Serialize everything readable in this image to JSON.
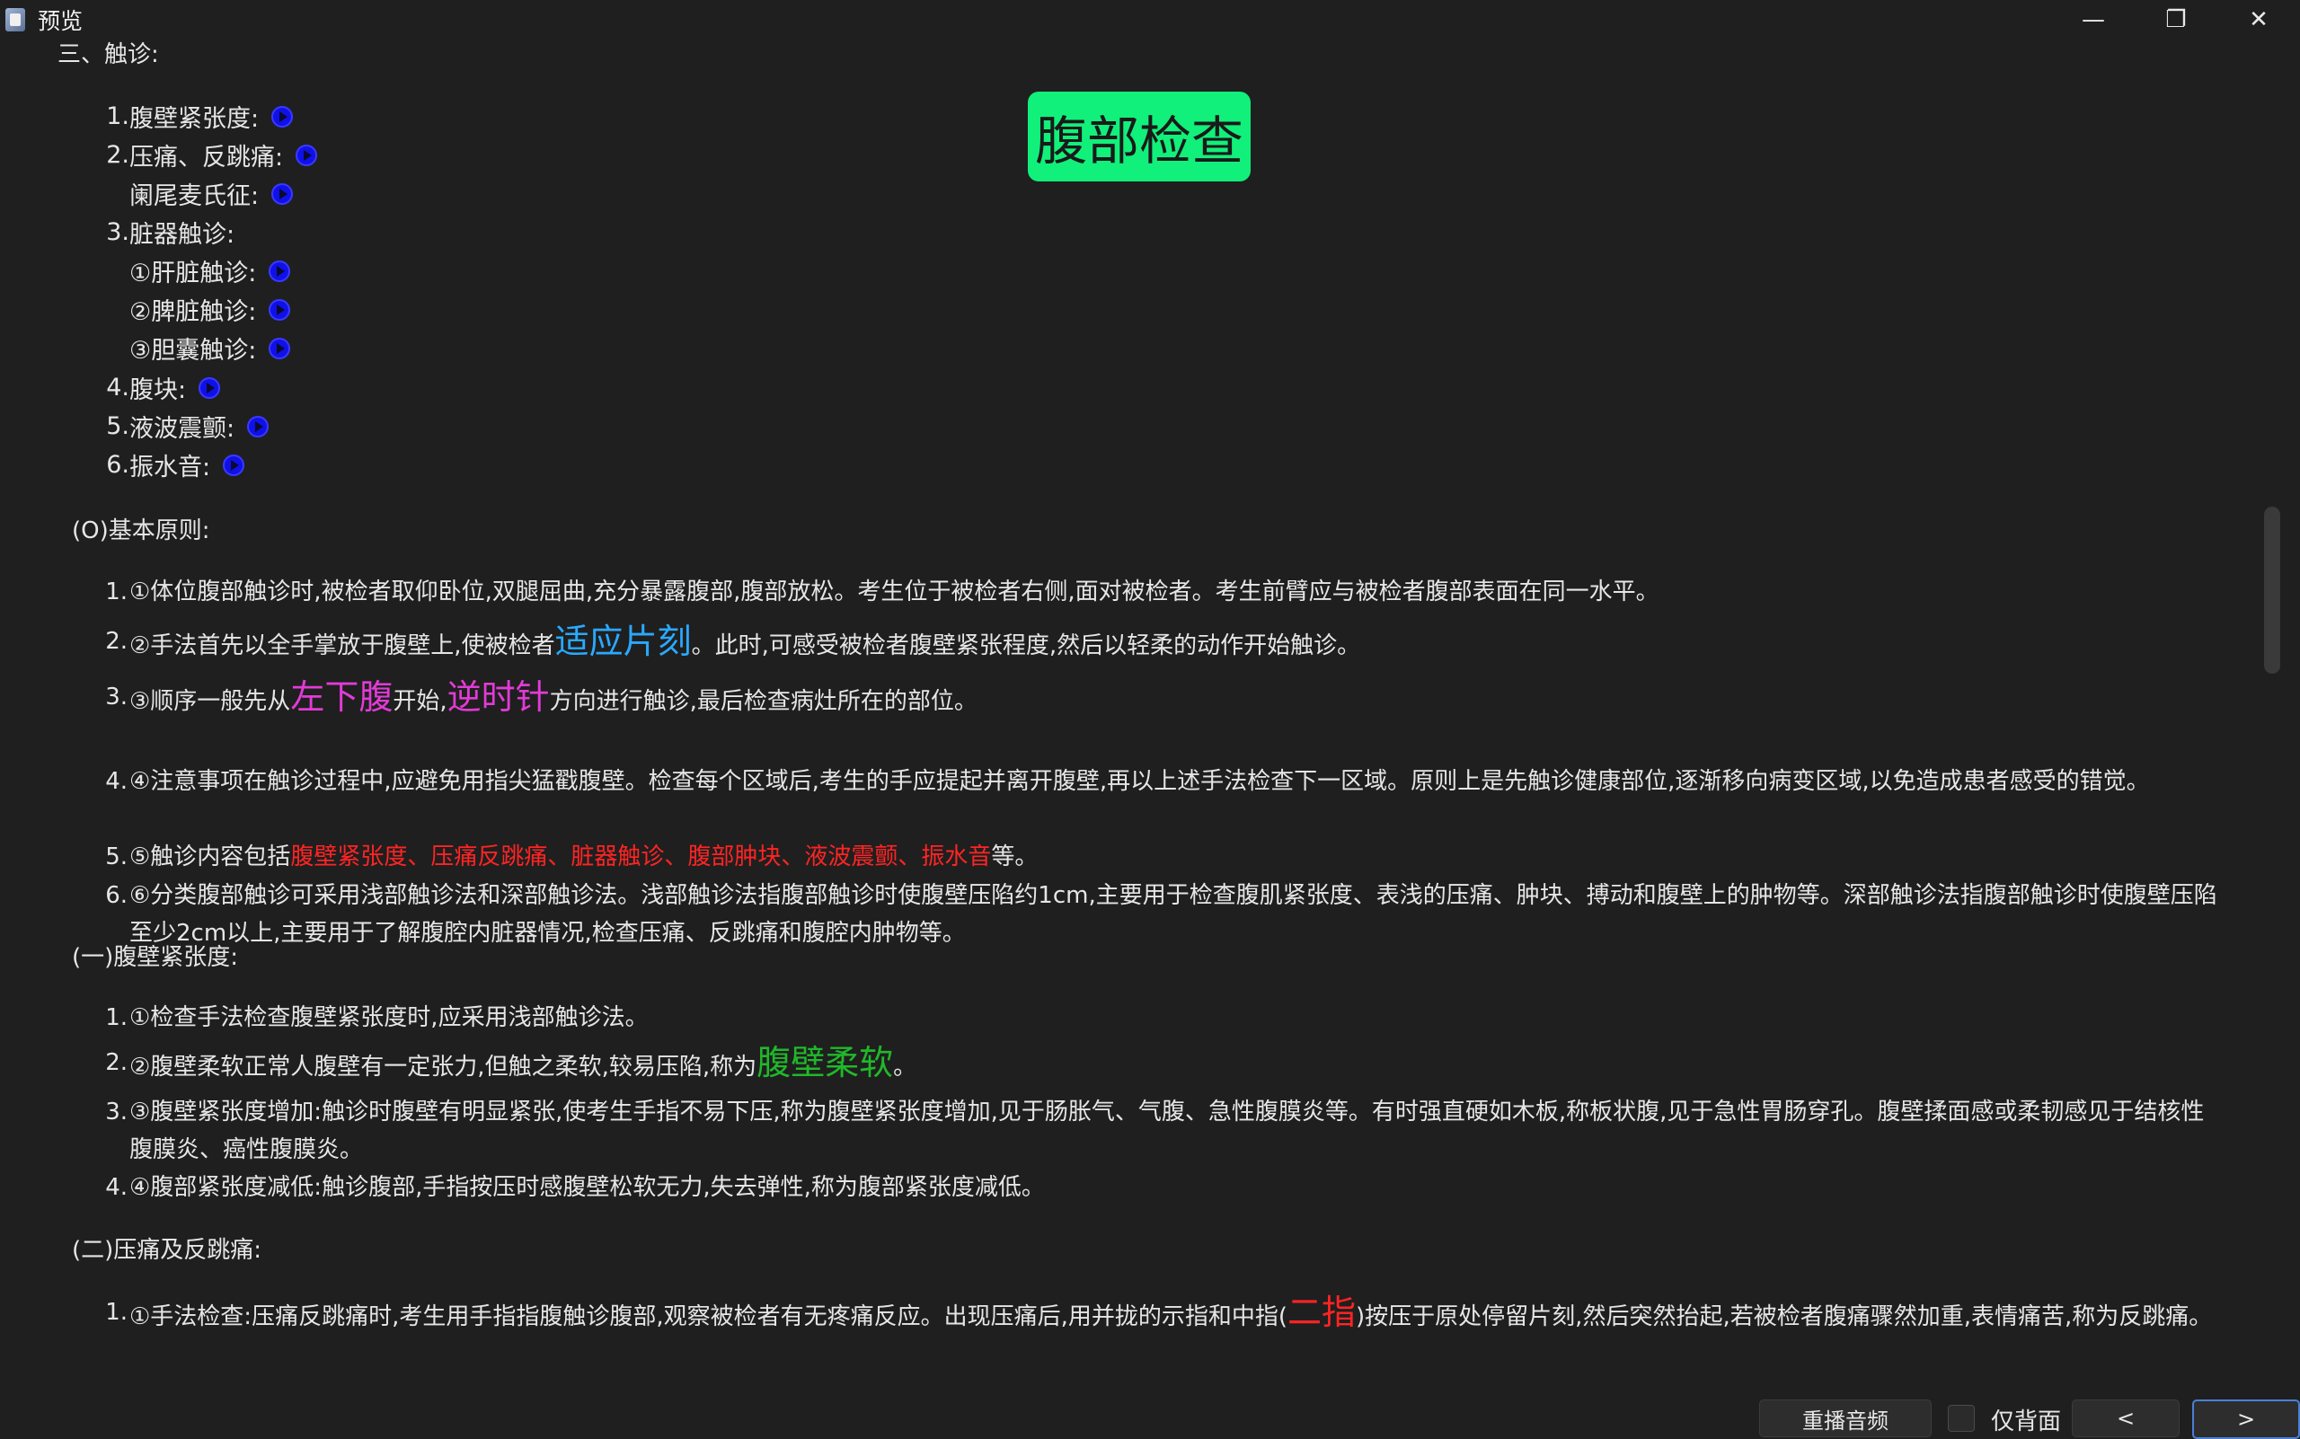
{
  "window": {
    "title": "预览",
    "minimize": "—",
    "maximize": "❐",
    "close": "✕"
  },
  "badge": "腹部检查",
  "section_title": "三、触诊:",
  "toc": [
    {
      "num": "1.",
      "label": "腹壁紧张度:"
    },
    {
      "num": "2.",
      "label": "压痛、反跳痛:"
    },
    {
      "num": "",
      "label": "阑尾麦氏征:"
    },
    {
      "num": "3.",
      "label": "脏器触诊:"
    },
    {
      "num": "",
      "label": "①肝脏触诊:"
    },
    {
      "num": "",
      "label": "②脾脏触诊:"
    },
    {
      "num": "",
      "label": "③胆囊触诊:"
    },
    {
      "num": "4.",
      "label": "腹块:"
    },
    {
      "num": "5.",
      "label": "液波震颤:"
    },
    {
      "num": "6.",
      "label": "振水音:"
    }
  ],
  "basic": {
    "heading": "(O)基本原则:",
    "items": [
      {
        "num": "1.",
        "text": "①体位腹部触诊时,被检者取仰卧位,双腿屈曲,充分暴露腹部,腹部放松。考生位于被检者右侧,面对被检者。考生前臂应与被检者腹部表面在同一水平。"
      },
      {
        "num": "2.",
        "pre": "②手法首先以全手掌放于腹壁上,使被检者",
        "hl": "适应片刻",
        "post": "。此时,可感受被检者腹壁紧张程度,然后以轻柔的动作开始触诊。"
      },
      {
        "num": "3.",
        "pre": "③顺序一般先从",
        "hl1": "左下腹",
        "mid": "开始,",
        "hl2": "逆时针",
        "post": "方向进行触诊,最后检查病灶所在的部位。"
      },
      {
        "num": "4.",
        "text": "④注意事项在触诊过程中,应避免用指尖猛戳腹壁。检查每个区域后,考生的手应提起并离开腹壁,再以上述手法检查下一区域。原则上是先触诊健康部位,逐渐移向病变区域,以免造成患者感受的错觉。"
      },
      {
        "num": "5.",
        "pre": "⑤触诊内容包括",
        "hl": "腹壁紧张度、压痛反跳痛、脏器触诊、腹部肿块、液波震颤、振水音",
        "post": "等。"
      },
      {
        "num": "6.",
        "text": "⑥分类腹部触诊可采用浅部触诊法和深部触诊法。浅部触诊法指腹部触诊时使腹壁压陷约1cm,主要用于检查腹肌紧张度、表浅的压痛、肿块、搏动和腹壁上的肿物等。深部触诊法指腹部触诊时使腹壁压陷至少2cm以上,主要用于了解腹腔内脏器情况,检查压痛、反跳痛和腹腔内肿物等。"
      }
    ]
  },
  "tension": {
    "heading": "(一)腹壁紧张度:",
    "items": [
      {
        "num": "1.",
        "text": "①检查手法检查腹壁紧张度时,应采用浅部触诊法。"
      },
      {
        "num": "2.",
        "pre": "②腹壁柔软正常人腹壁有一定张力,但触之柔软,较易压陷,称为",
        "hl": "腹壁柔软",
        "post": "。"
      },
      {
        "num": "3.",
        "text": "③腹壁紧张度增加:触诊时腹壁有明显紧张,使考生手指不易下压,称为腹壁紧张度增加,见于肠胀气、气腹、急性腹膜炎等。有时强直硬如木板,称板状腹,见于急性胃肠穿孔。腹壁揉面感或柔韧感见于结核性腹膜炎、癌性腹膜炎。"
      },
      {
        "num": "4.",
        "text": "④腹部紧张度减低:触诊腹部,手指按压时感腹壁松软无力,失去弹性,称为腹部紧张度减低。"
      }
    ]
  },
  "tenderness": {
    "heading": "(二)压痛及反跳痛:",
    "items": [
      {
        "num": "1.",
        "pre": "①手法检查:压痛反跳痛时,考生用手指指腹触诊腹部,观察被检者有无疼痛反应。出现压痛后,用并拢的示指和中指(",
        "hl": "二指",
        "post": ")按压于原处停留片刻,然后突然抬起,若被检者腹痛骤然加重,表情痛苦,称为反跳痛。"
      }
    ]
  },
  "bottom": {
    "replay": "重播音频",
    "back_only": "仅背面",
    "prev": "<",
    "next": ">"
  }
}
